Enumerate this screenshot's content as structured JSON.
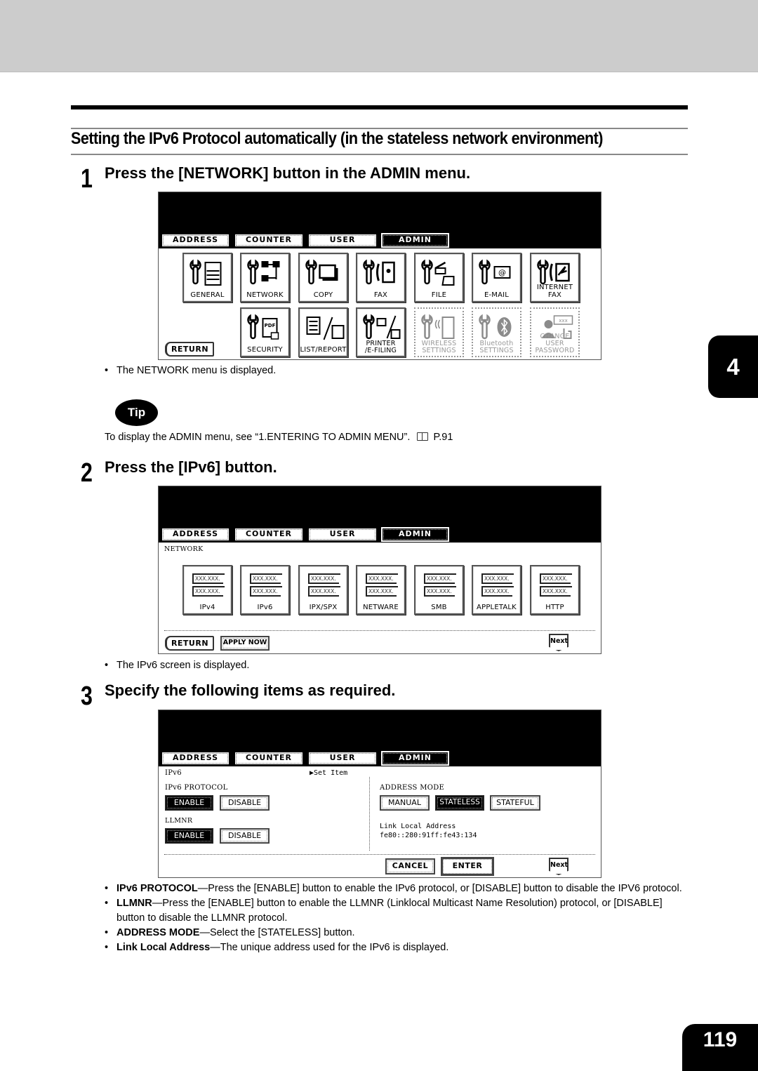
{
  "page": {
    "section_title": "Setting the IPv6 Protocol automatically (in the stateless network environment)",
    "chapter_number": "4",
    "page_number": "119"
  },
  "steps": [
    {
      "number": "1",
      "text": "Press the [NETWORK] button in the ADMIN menu."
    },
    {
      "number": "2",
      "text": "Press the [IPv6] button."
    },
    {
      "number": "3",
      "text": "Specify the following items as required."
    }
  ],
  "notes": {
    "after_step1": "The NETWORK menu is displayed.",
    "after_step2": "The IPv6 screen is displayed.",
    "bullet": "•"
  },
  "tip": {
    "badge": "Tip",
    "text": "To display the ADMIN menu, see “1.ENTERING TO ADMIN MENU”.",
    "icon": "book-icon",
    "page_ref": "P.91"
  },
  "lcd_tabs": [
    "ADDRESS",
    "COUNTER",
    "USER",
    "ADMIN"
  ],
  "lcd_active_tab": "ADMIN",
  "screen1": {
    "row1": [
      {
        "label": "GENERAL",
        "icon": "general-icon"
      },
      {
        "label": "NETWORK",
        "icon": "network-icon"
      },
      {
        "label": "COPY",
        "icon": "copy-icon"
      },
      {
        "label": "FAX",
        "icon": "fax-icon"
      },
      {
        "label": "FILE",
        "icon": "file-icon"
      },
      {
        "label": "E-MAIL",
        "icon": "email-icon"
      },
      {
        "label": "INTERNET FAX",
        "icon": "internet-fax-icon"
      }
    ],
    "row2": [
      {
        "label": "SECURITY",
        "icon": "security-icon",
        "enabled": true
      },
      {
        "label": "LIST/REPORT",
        "icon": "list-report-icon",
        "enabled": true
      },
      {
        "label": "PRINTER\n/E-FILING",
        "icon": "printer-efiling-icon",
        "enabled": true
      },
      {
        "label": "WIRELESS\nSETTINGS",
        "icon": "wireless-icon",
        "enabled": false
      },
      {
        "label": "Bluetooth\nSETTINGS",
        "icon": "bluetooth-icon",
        "enabled": false
      },
      {
        "label": "CHANGE USER\nPASSWORD",
        "icon": "change-password-icon",
        "enabled": false
      }
    ],
    "return_label": "RETURN"
  },
  "screen2": {
    "title": "NETWORK",
    "placeholder_addr": "XXX.XXX.",
    "items": [
      "IPv4",
      "IPv6",
      "IPX/SPX",
      "NETWARE",
      "SMB",
      "APPLETALK",
      "HTTP"
    ],
    "return_label": "RETURN",
    "apply_label": "APPLY NOW",
    "next_label": "Next"
  },
  "screen3": {
    "title": "IPv6",
    "set_item": "▶Set Item",
    "ipv6_protocol": {
      "label": "IPv6 PROTOCOL",
      "enable": "ENABLE",
      "disable": "DISABLE",
      "selected": "ENABLE"
    },
    "llmnr": {
      "label": "LLMNR",
      "enable": "ENABLE",
      "disable": "DISABLE",
      "selected": "ENABLE"
    },
    "address_mode": {
      "label": "ADDRESS MODE",
      "options": [
        "MANUAL",
        "STATELESS",
        "STATEFUL"
      ],
      "selected": "STATELESS"
    },
    "link_local": {
      "label": "Link Local Address",
      "value": "fe80::280:91ff:fe43:134"
    },
    "cancel_label": "CANCEL",
    "enter_label": "ENTER",
    "next_label": "Next"
  },
  "descriptions": [
    {
      "term": "IPv6 PROTOCOL",
      "text": "—Press the [ENABLE] button to enable the IPv6 protocol, or [DISABLE] button to disable the IPV6 protocol."
    },
    {
      "term": "LLMNR",
      "text": "—Press the [ENABLE] button to enable the LLMNR (Linklocal Multicast Name Resolution) protocol, or [DISABLE] button to disable the LLMNR protocol."
    },
    {
      "term": "ADDRESS MODE",
      "text": "—Select the [STATELESS] button."
    },
    {
      "term": "Link Local Address",
      "text": "—The unique address used for the IPv6 is displayed."
    }
  ]
}
